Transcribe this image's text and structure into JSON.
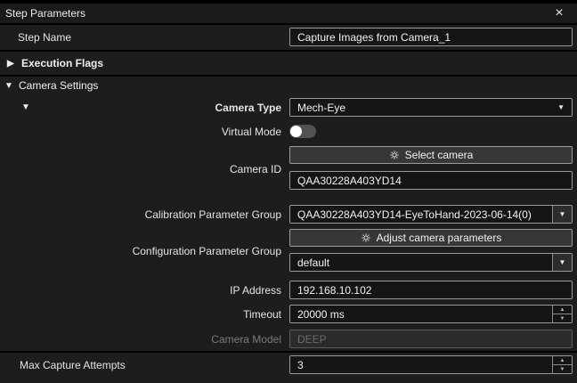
{
  "titlebar": {
    "title": "Step Parameters"
  },
  "icons": {
    "close": "×",
    "expanded": "▼",
    "collapsed": "▶",
    "combo_arrow": "▼",
    "spin_up": "▲",
    "spin_down": "▼"
  },
  "colors": {
    "panel_bg": "#1d1d1d",
    "field_bg": "#151515",
    "button_bg": "#373737",
    "field_border": "#9a9a9a",
    "text": "#f2f2f2",
    "disabled_text": "#6d6d6d"
  },
  "step_name": {
    "label": "Step Name",
    "value": "Capture Images from Camera_1"
  },
  "sections": {
    "execution_flags": {
      "label": "Execution Flags",
      "state": "collapsed"
    },
    "camera_settings": {
      "label": "Camera Settings",
      "state": "expanded"
    }
  },
  "camera": {
    "camera_type": {
      "label": "Camera Type",
      "value": "Mech-Eye"
    },
    "virtual_mode": {
      "label": "Virtual Mode",
      "enabled": false
    },
    "select_camera_button": {
      "label": "Select camera"
    },
    "camera_id": {
      "label": "Camera ID",
      "value": "QAA30228A403YD14"
    },
    "calibration_parameter_group": {
      "label": "Calibration Parameter Group",
      "value": "QAA30228A403YD14-EyeToHand-2023-06-14(0)"
    },
    "adjust_camera_parameters_button": {
      "label": "Adjust camera parameters"
    },
    "configuration_parameter_group": {
      "label": "Configuration Parameter Group",
      "value": "default"
    },
    "ip_address": {
      "label": "IP Address",
      "value": "192.168.10.102"
    },
    "timeout": {
      "label": "Timeout",
      "value": "20000 ms"
    },
    "camera_model": {
      "label": "Camera Model",
      "value": "DEEP"
    }
  },
  "max_capture_attempts": {
    "label": "Max Capture Attempts",
    "value": "3"
  }
}
